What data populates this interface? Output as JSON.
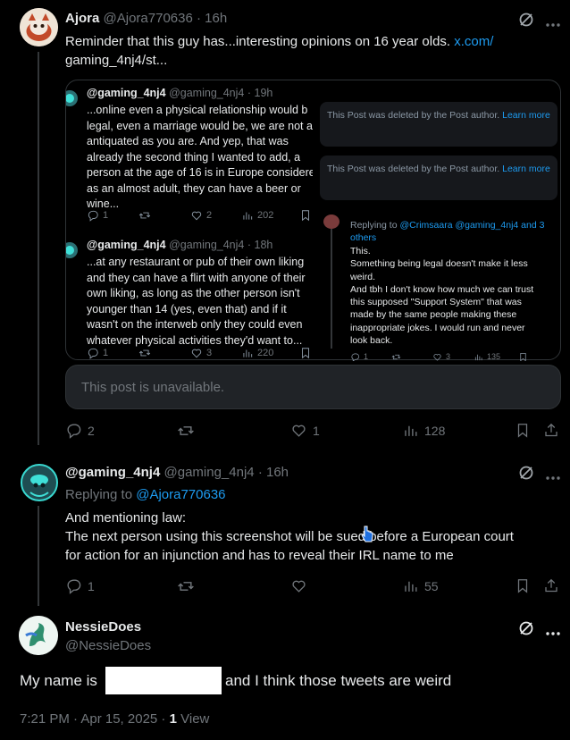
{
  "tweet1": {
    "name": "Ajora",
    "handle": "@Ajora770636",
    "time": "· 16h",
    "text": "Reminder that this guy has...interesting opinions on 16 year olds.",
    "link1": "x.com/",
    "link2": "gaming_4nj4/st...",
    "stats": {
      "replies": "2",
      "reposts": "",
      "likes": "1",
      "views": "128"
    }
  },
  "quote_left": {
    "post1": {
      "name": "@gaming_4nj4",
      "handle": "@gaming_4nj4",
      "time": "· 19h",
      "lines": [
        "...online even a physical relationship would b",
        "legal, even a marriage would be, we are not a",
        "antiquated as you are. And yep, that was",
        "already the second thing I wanted to add, a",
        "person at the age of 16 is in Europe considere",
        "as an almost adult, they can have a beer or",
        "wine..."
      ],
      "stats": {
        "replies": "1",
        "likes": "2",
        "views": "202"
      }
    },
    "post2": {
      "name": "@gaming_4nj4",
      "handle": "@gaming_4nj4",
      "time": "· 18h",
      "lines": [
        "...at any restaurant or pub of their own liking",
        "and they can have a flirt with anyone of their",
        "own liking, as long as the other person isn't",
        "younger than 14 (yes, even that) and if it",
        "wasn't on the interweb only they could even",
        "whatever physical activities they'd want to..."
      ],
      "stats": {
        "replies": "1",
        "likes": "3",
        "views": "220"
      }
    }
  },
  "quote_right": {
    "deleted1": "This Post was deleted by the Post author.",
    "deleted1_link": "Learn more",
    "deleted2": "This Post was deleted by the Post author.",
    "deleted2_link": "Learn more",
    "reply": {
      "replying_prefix": "Replying to",
      "replying_to": "@Crimsaara @gaming_4nj4 and 3 others",
      "lines": [
        "This.",
        "Something being legal doesn't make it less",
        "weird.",
        "And tbh I don't know how much we can trust",
        "this supposed \"Support System\" that was",
        "made by the same people making these",
        "inappropriate jokes. I would run and never",
        "look back."
      ],
      "stats": {
        "replies": "1",
        "likes": "3",
        "views": "135"
      }
    }
  },
  "unavailable": "This post is unavailable.",
  "tweet2": {
    "name": "@gaming_4nj4",
    "handle": "@gaming_4nj4",
    "time": "· 16h",
    "replying_prefix": "Replying to",
    "replying_to": "@Ajora770636",
    "lines": [
      "And mentioning law:",
      "The next person using this screenshot will be sued before a European court",
      "for action for an injunction and has to reveal their IRL name to me"
    ],
    "stats": {
      "replies": "1",
      "views": "55"
    }
  },
  "tweet3": {
    "name": "NessieDoes",
    "handle": "@NessieDoes",
    "text_before": "My name is",
    "text_after": "and I think those tweets are weird",
    "time": "7:21 PM · Apr 15, 2025 ·",
    "views_count": "1",
    "views_label": "View"
  },
  "icons": [
    "grok-icon",
    "more-icon",
    "reply-icon",
    "repost-icon",
    "like-icon",
    "views-icon",
    "bookmark-icon",
    "share-icon"
  ],
  "colors": {
    "background": "#000000",
    "accent": "#1d9bf0",
    "muted": "#71767b",
    "text": "#e7e9ea"
  }
}
